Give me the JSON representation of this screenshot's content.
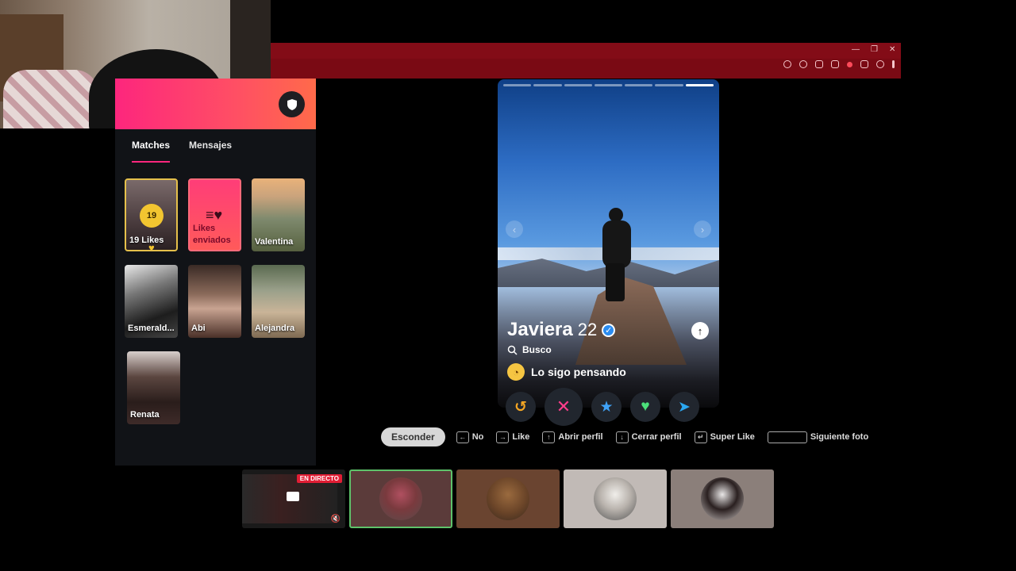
{
  "sidebar": {
    "tabs": [
      {
        "label": "Matches",
        "active": true
      },
      {
        "label": "Mensajes",
        "active": false
      }
    ],
    "likes_count": "19",
    "likes_label": "19 Likes",
    "sent_label": "Likes enviados",
    "matches": [
      {
        "name": "Valentina"
      },
      {
        "name": "Esmerald..."
      },
      {
        "name": "Abi"
      },
      {
        "name": "Alejandra"
      },
      {
        "name": "Renata"
      }
    ]
  },
  "profile": {
    "name": "Javiera",
    "age": "22",
    "looking_label": "Busco",
    "looking_for": "Lo sigo pensando",
    "photo_index": 7,
    "photo_count": 7
  },
  "actions": [
    {
      "name": "rewind",
      "icon": "rewind-icon",
      "glyph": "↺"
    },
    {
      "name": "nope",
      "icon": "close-icon",
      "glyph": "✕"
    },
    {
      "name": "super-like",
      "icon": "star-icon",
      "glyph": "★"
    },
    {
      "name": "like",
      "icon": "heart-icon",
      "glyph": "♥"
    },
    {
      "name": "boost",
      "icon": "send-icon",
      "glyph": "➤"
    }
  ],
  "shortcuts": {
    "hide_label": "Esconder",
    "no": "No",
    "like": "Like",
    "open_profile": "Abrir perfil",
    "close_profile": "Cerrar perfil",
    "super_like": "Super Like",
    "next_photo": "Siguiente foto"
  },
  "stream": {
    "live_badge": "EN DIRECTO"
  },
  "colors": {
    "brand_pink": "#fd267d",
    "browser_frame": "#7a0a14",
    "likes_gold": "#f2c530",
    "verified_blue": "#2b8cf0"
  }
}
